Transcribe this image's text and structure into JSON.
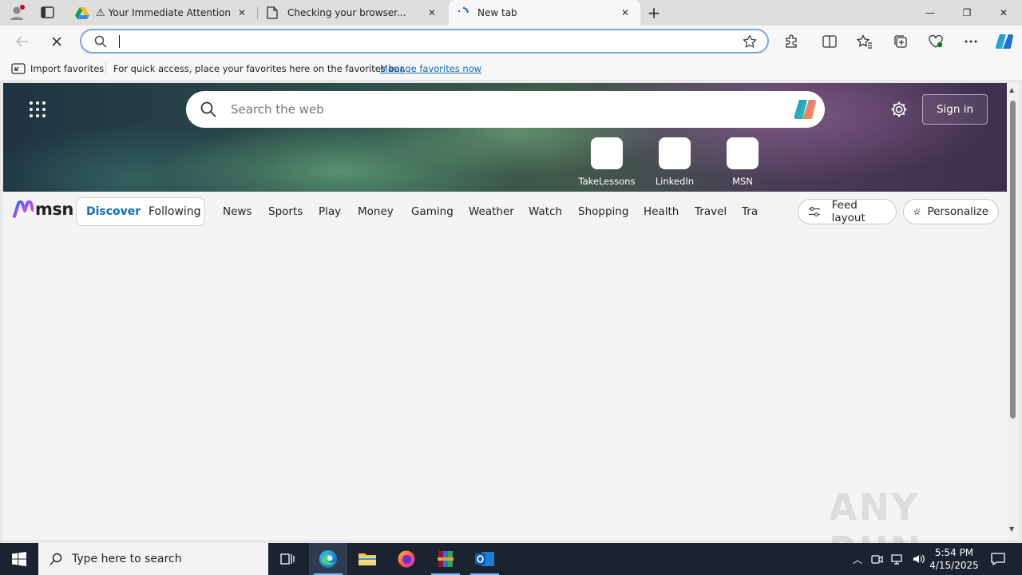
{
  "tabs": [
    {
      "title": "Your Immediate Attention Is Requ",
      "icon": "warning-icon"
    },
    {
      "title": "Checking your browser...",
      "icon": "page-icon"
    },
    {
      "title": "New tab",
      "icon": "loading-spinner-icon"
    }
  ],
  "window_controls": {
    "minimize": "—",
    "restore": "❐",
    "close": "✕"
  },
  "address_bar": {
    "value": "",
    "placeholder": ""
  },
  "favorites_bar": {
    "import_label": "Import favorites",
    "hint": "For quick access, place your favorites here on the favorites bar.",
    "manage_link": "Manage favorites now"
  },
  "hero": {
    "search_placeholder": "Search the web",
    "signin_label": "Sign in",
    "quick_links": [
      {
        "label": "TakeLessons"
      },
      {
        "label": "LinkedIn"
      },
      {
        "label": "MSN"
      }
    ]
  },
  "msn": {
    "logo_text": "msn",
    "pill": {
      "discover": "Discover",
      "following": "Following"
    },
    "nav": [
      "News",
      "Sports",
      "Play",
      "Money",
      "Gaming",
      "Weather",
      "Watch",
      "Shopping",
      "Health",
      "Travel",
      "Traffic"
    ],
    "feed_layout_label": "Feed layout",
    "personalize_label": "Personalize"
  },
  "watermark": "ANY RUN",
  "taskbar": {
    "search_placeholder": "Type here to search",
    "time": "5:54 PM",
    "date": "4/15/2025"
  },
  "colors": {
    "accent": "#0f6cbd",
    "taskbar": "#1c2330",
    "address_border": "#7aa7d9"
  }
}
